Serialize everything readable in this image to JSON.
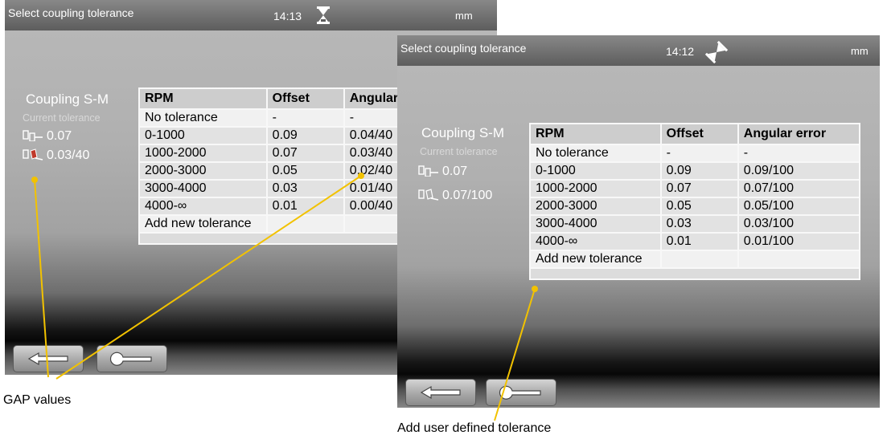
{
  "left_screen": {
    "title": "Select coupling tolerance",
    "time": "14:13",
    "unit": "mm",
    "status_icon": "hourglass-icon",
    "coupling_name": "Coupling S-M",
    "current_tolerance_label": "Current tolerance",
    "offset_value": "0.07",
    "angular_value": "0.03/40",
    "columns": [
      "RPM",
      "Offset",
      "Angular error"
    ],
    "rows": [
      [
        "No tolerance",
        "-",
        "-"
      ],
      [
        "0-1000",
        "0.09",
        "0.04/40"
      ],
      [
        "1000-2000",
        "0.07",
        "0.03/40"
      ],
      [
        "2000-3000",
        "0.05",
        "0.02/40"
      ],
      [
        "3000-4000",
        "0.03",
        "0.01/40"
      ],
      [
        "4000-∞",
        "0.01",
        "0.00/40"
      ]
    ],
    "add_row_label": "Add new tolerance",
    "buttons": {
      "back_icon": "back-arrow-icon",
      "wrench_icon": "wrench-icon"
    }
  },
  "right_screen": {
    "title": "Select coupling tolerance",
    "time": "14:12",
    "unit": "mm",
    "status_icon": "hourglass-tilted-icon",
    "coupling_name": "Coupling S-M",
    "current_tolerance_label": "Current tolerance",
    "offset_value": "0.07",
    "angular_value": "0.07/100",
    "columns": [
      "RPM",
      "Offset",
      "Angular error"
    ],
    "rows": [
      [
        "No tolerance",
        "-",
        "-"
      ],
      [
        "0-1000",
        "0.09",
        "0.09/100"
      ],
      [
        "1000-2000",
        "0.07",
        "0.07/100"
      ],
      [
        "2000-3000",
        "0.05",
        "0.05/100"
      ],
      [
        "3000-4000",
        "0.03",
        "0.03/100"
      ],
      [
        "4000-∞",
        "0.01",
        "0.01/100"
      ]
    ],
    "add_row_label": "Add new tolerance",
    "buttons": {
      "back_icon": "back-arrow-icon",
      "wrench_icon": "wrench-icon"
    }
  },
  "callouts": {
    "gap_values": "GAP values",
    "add_user_tolerance": "Add user defined tolerance",
    "line_color": "#f2c200"
  },
  "header_icon": "green-circle-icon"
}
